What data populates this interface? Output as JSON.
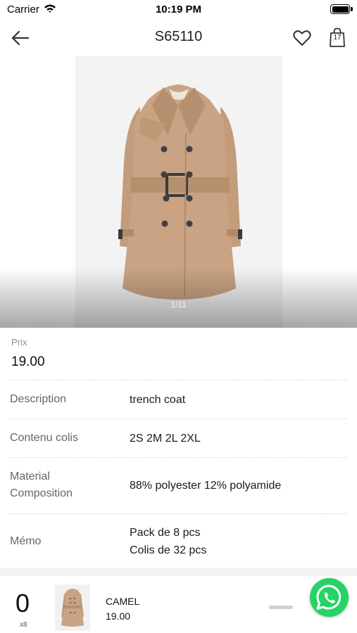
{
  "status_bar": {
    "carrier": "Carrier",
    "time": "10:19 PM",
    "icons": [
      "wifi-icon",
      "battery-icon"
    ]
  },
  "nav": {
    "title": "S65110",
    "icons": [
      "back-arrow-icon",
      "heart-icon",
      "shopping-bag-icon"
    ],
    "cart_count": "17"
  },
  "gallery": {
    "page_indicator": "1/11",
    "image": "camel trench coat photo"
  },
  "product": {
    "price_label": "Prix",
    "price": "19.00",
    "details": [
      {
        "label": "Description",
        "value": "trench coat"
      },
      {
        "label": "Contenu colis",
        "value": "2S 2M 2L 2XL"
      },
      {
        "label": "Material Composition",
        "value": "88% polyester 12% polyamide"
      },
      {
        "label": "Mémo",
        "value_lines": [
          "Pack de 8 pcs",
          "Colis de 32 pcs"
        ]
      }
    ]
  },
  "bottom_bar": {
    "quantity": "0",
    "unit": "x8",
    "variant_color": "CAMEL",
    "variant_price": "19.00",
    "icons": [
      "minus-icon",
      "whatsapp-icon"
    ]
  },
  "colors": {
    "whatsapp": "#25d366",
    "coat": "#c9a383"
  }
}
